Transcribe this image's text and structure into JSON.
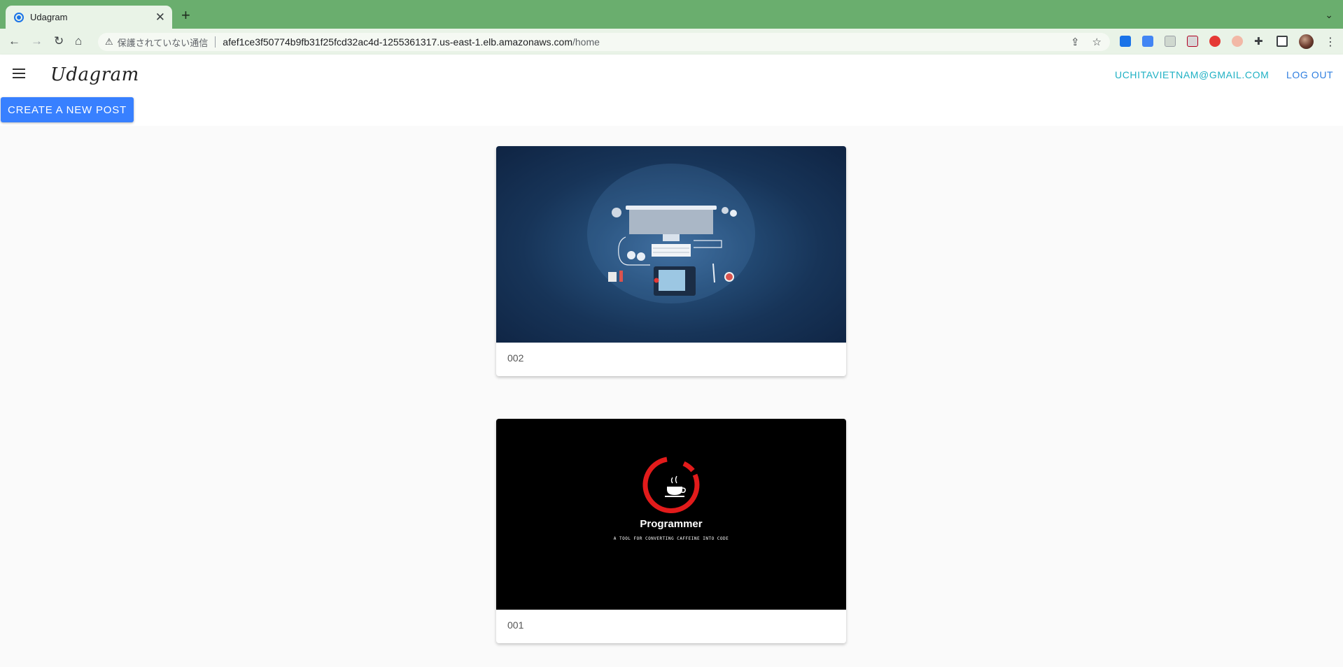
{
  "browser": {
    "tab_title": "Udagram",
    "not_secure_label": "保護されていない通信",
    "url_host": "afef1ce3f50774b9fb31f25fcd32ac4d-1255361317.us-east-1.elb.amazonaws.com",
    "url_path": "/home"
  },
  "header": {
    "brand": "Udagram",
    "user_email": "UCHITAVIETNAM@GMAIL.COM",
    "logout_label": "LOG OUT"
  },
  "actions": {
    "create_post_label": "CREATE A NEW POST"
  },
  "feed": [
    {
      "caption": "002"
    },
    {
      "caption": "001",
      "image_title": "Programmer",
      "image_subtitle": "A TOOL FOR CONVERTING CAFFEINE INTO CODE"
    }
  ],
  "colors": {
    "chrome_tab_bar": "#6aae6e",
    "chrome_toolbar": "#e9f3e7",
    "primary_button": "#3880ff",
    "email_link": "#1fb1c4",
    "logout_link": "#2f7fe0"
  }
}
